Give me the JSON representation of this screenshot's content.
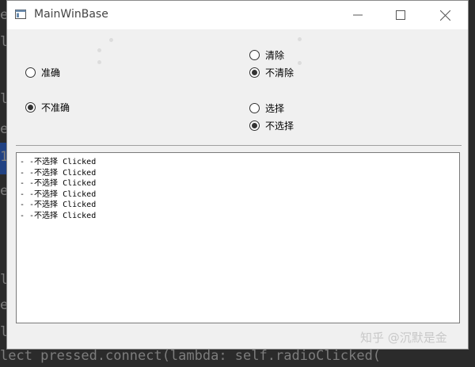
{
  "background": {
    "code_lines": [
      "e",
      "ls",
      "l",
      "e",
      "1",
      "e",
      "",
      "",
      "",
      "",
      "l.",
      "e",
      "",
      "la"
    ],
    "bottom_code": "lect pressed.connect(lambda: self.radioClicked("
  },
  "window": {
    "title": "MainWinBase",
    "buttons": {
      "minimize": "minimize",
      "maximize": "maximize",
      "close": "close"
    }
  },
  "radios": {
    "accurate": {
      "label": "准确",
      "checked": false
    },
    "not_accurate": {
      "label": "不准确",
      "checked": true
    },
    "clear": {
      "label": "清除",
      "checked": false
    },
    "not_clear": {
      "label": "不清除",
      "checked": true
    },
    "select": {
      "label": "选择",
      "checked": false
    },
    "not_select": {
      "label": "不选择",
      "checked": true
    }
  },
  "log": {
    "lines": [
      "- -不选择 Clicked",
      "- -不选择 Clicked",
      "- -不选择 Clicked",
      "- -不选择 Clicked",
      "- -不选择 Clicked",
      "- -不选择 Clicked"
    ]
  },
  "watermark": "知乎 @沉默是金"
}
